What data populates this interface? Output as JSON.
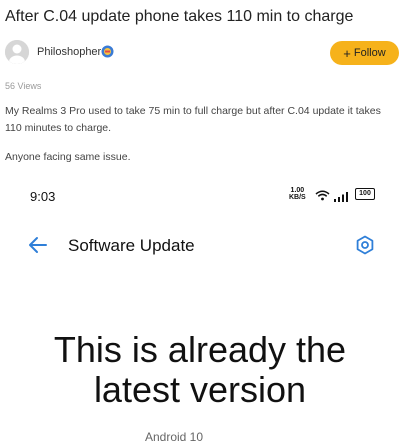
{
  "post": {
    "title": "After C.04 update phone takes 110 min to charge",
    "author": "Philoshopher",
    "follow_label": "Follow",
    "views": "56 Views",
    "body": "My Realms 3 Pro used to take 75 min to full charge but after C.04 update it takes 110 minutes to charge.",
    "body2": "Anyone facing same issue."
  },
  "phone": {
    "status": {
      "time": "9:03",
      "speed_value": "1.00",
      "speed_unit": "KB/S",
      "battery": "100"
    },
    "header": {
      "title": "Software Update"
    },
    "message_line1": "This is already the",
    "message_line2": "latest version",
    "android_version": "Android 10"
  },
  "colors": {
    "accent": "#f6b21b",
    "icon_blue": "#2f7fd8"
  },
  "icons": [
    "avatar",
    "badge-icon",
    "wifi-icon",
    "signal-icon",
    "battery-icon",
    "back-arrow-icon",
    "settings-icon"
  ]
}
